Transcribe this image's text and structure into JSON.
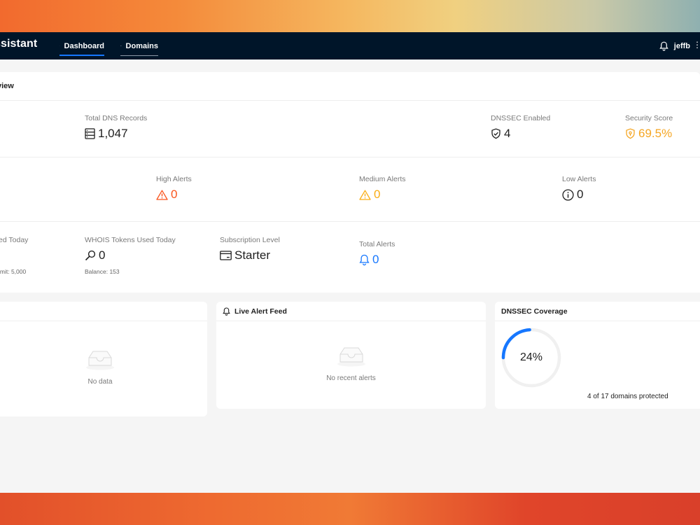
{
  "app": {
    "brand": "ssistant"
  },
  "nav": {
    "items": [
      {
        "label": "Dashboard",
        "icon": "dashboard-icon",
        "active": true
      },
      {
        "label": "Domains",
        "icon": "list-icon",
        "active": false
      }
    ],
    "user": {
      "name": "jeffb",
      "icon": "bell-icon"
    }
  },
  "overview": {
    "title": "view",
    "row1": [
      {
        "label": "Total DNS Records",
        "value": "1,047",
        "icon": "database-icon"
      },
      {
        "label": "DNSSEC Enabled",
        "value": "4",
        "icon": "shield-check-icon"
      },
      {
        "label": "Security Score",
        "value": "69.5%",
        "icon": "security-badge-icon",
        "color": "#f5a623"
      }
    ],
    "row2": [
      {
        "label": "High Alerts",
        "value": "0",
        "icon": "warning-icon",
        "color": "#fa541c"
      },
      {
        "label": "Medium Alerts",
        "value": "0",
        "icon": "warning-icon",
        "color": "#faad14"
      },
      {
        "label": "Low Alerts",
        "value": "0",
        "icon": "info-icon"
      }
    ],
    "row3": [
      {
        "label": "ed Today",
        "sub": "imit: 5,000"
      },
      {
        "label": "WHOIS Tokens Used Today",
        "value": "0",
        "icon": "search-icon",
        "sub": "Balance: 153"
      },
      {
        "label": "Subscription Level",
        "value": "Starter",
        "icon": "card-icon"
      },
      {
        "label": "Total Alerts",
        "value": "0",
        "icon": "bell-icon",
        "color": "#1677ff"
      }
    ]
  },
  "cards": {
    "left": {
      "empty_text": "No data"
    },
    "alerts": {
      "title": "Live Alert Feed",
      "empty_text": "No recent alerts"
    },
    "dnssec": {
      "title": "DNSSEC Coverage",
      "percent_label": "24%",
      "percent": 24,
      "subtitle": "4 of 17 domains protected"
    }
  },
  "colors": {
    "topbar": "#001529",
    "accent": "#1677ff",
    "warning": "#faad14",
    "danger": "#fa541c"
  }
}
